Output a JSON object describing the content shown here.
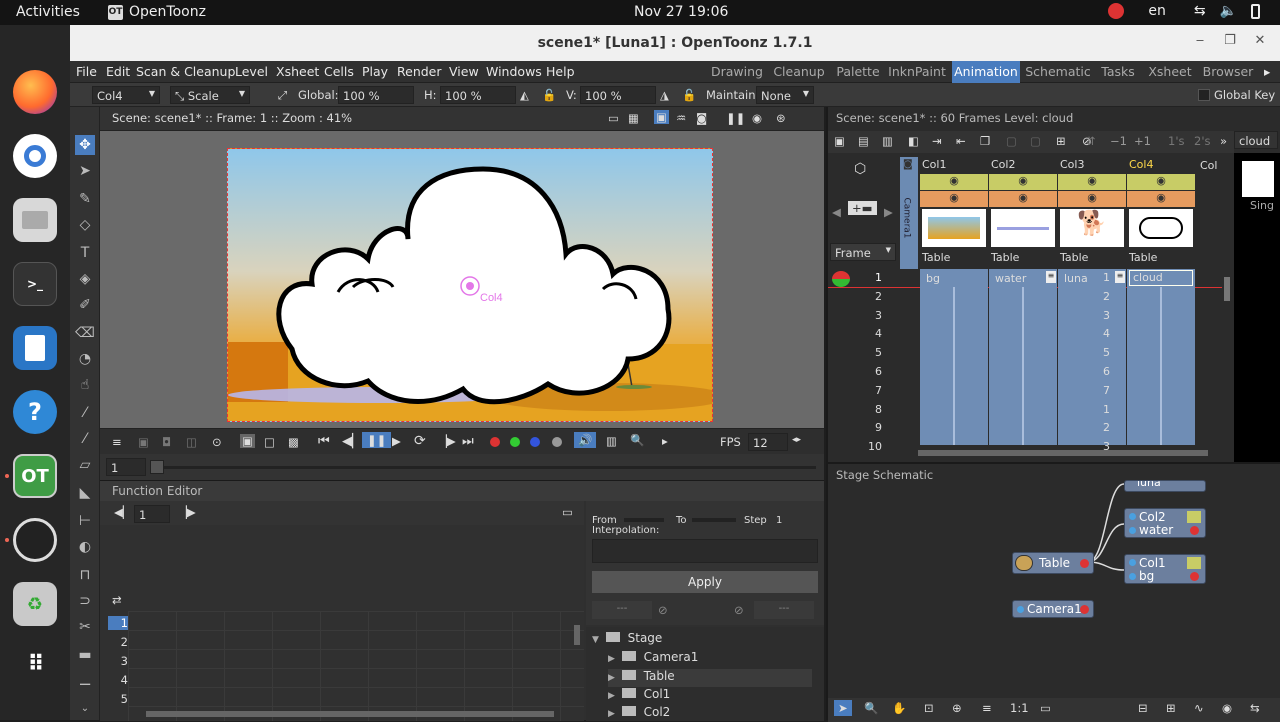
{
  "topbar": {
    "activities": "Activities",
    "app_name": "OpenToonz",
    "clock": "Nov 27  19:06",
    "lang": "en"
  },
  "window": {
    "title": "scene1* [Luna1] : OpenToonz 1.7.1"
  },
  "menu": [
    "File",
    "Edit",
    "Scan & Cleanup",
    "Level",
    "Xsheet",
    "Cells",
    "Play",
    "Render",
    "View",
    "Windows",
    "Help"
  ],
  "rooms": [
    "Drawing",
    "Cleanup",
    "Palette",
    "InknPaint",
    "Animation",
    "Schematic",
    "Tasks",
    "Xsheet",
    "Browser"
  ],
  "active_room": "Animation",
  "tool_options": {
    "object": "Col4",
    "mode": "Scale",
    "global_label": "Global:",
    "global_value": "100 %",
    "h_label": "H:",
    "h_value": "100 %",
    "v_label": "V:",
    "v_value": "100 %",
    "maintain_label": "Maintain:",
    "maintain_value": "None",
    "global_key": "Global Key"
  },
  "viewer": {
    "info": "Scene: scene1*   ::   Frame: 1   ::  Zoom : 41%",
    "pivot_label": "Col4"
  },
  "playbar": {
    "fps_label": "FPS",
    "fps_value": "12"
  },
  "framebar": {
    "frame": "1"
  },
  "function_editor": {
    "title": "Function Editor",
    "frame_value": "1",
    "from_label": "From",
    "to_label": "To",
    "step_label": "Step",
    "step_value": "1",
    "interp_label": "Interpolation:",
    "apply_label": "Apply",
    "dash_a": "---",
    "dash_b": "---",
    "rows": [
      "1",
      "2",
      "3",
      "4",
      "5"
    ],
    "tree": [
      "Stage",
      "Camera1",
      "Table",
      "Col1",
      "Col2"
    ]
  },
  "xsheet": {
    "header": "Scene: scene1*   ::   60 Frames  Level: cloud",
    "level_dropdown": "cloud",
    "single": "Sing",
    "frame_label": "Frame",
    "camera_label": "Camera1",
    "toolbar_values": [
      "−1",
      "+1",
      "1's",
      "2's"
    ],
    "columns": [
      {
        "name": "Col1",
        "parent": "Table",
        "level": "bg",
        "active": false
      },
      {
        "name": "Col2",
        "parent": "Table",
        "level": "water",
        "active": false
      },
      {
        "name": "Col3",
        "parent": "Table",
        "level": "luna",
        "active": false
      },
      {
        "name": "Col4",
        "parent": "Table",
        "level": "cloud",
        "active": true
      }
    ],
    "extra_col": "Col",
    "frames": [
      "1",
      "2",
      "3",
      "4",
      "5",
      "6",
      "7",
      "8",
      "9",
      "10"
    ],
    "col3_values": [
      "1",
      "2",
      "3",
      "4",
      "5",
      "6",
      "7",
      "1",
      "2",
      "3"
    ]
  },
  "schematic": {
    "title": "Stage Schematic",
    "nodes": {
      "table": "Table",
      "camera": "Camera1",
      "col1_name": "Col1",
      "col1_level": "bg",
      "col2_name": "Col2",
      "col2_level": "water",
      "col3_level": "luna"
    },
    "zoom_label": "1:1"
  }
}
